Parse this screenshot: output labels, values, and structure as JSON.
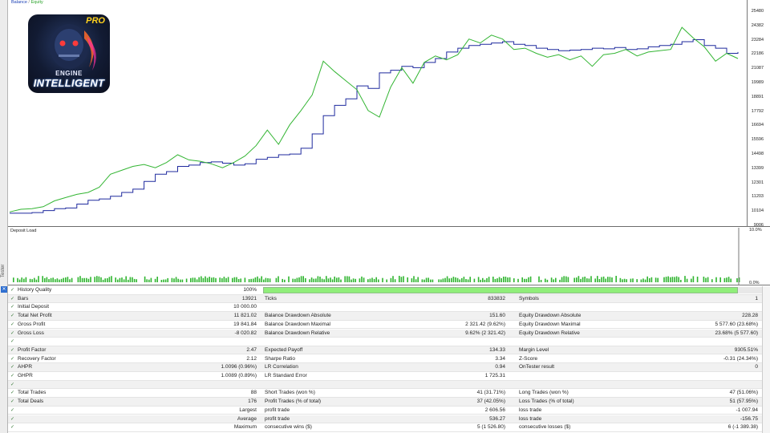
{
  "chart": {
    "legend_balance": "Balance",
    "legend_sep": "/",
    "legend_equity": "Equity",
    "y_ticks": [
      "25480",
      "24382",
      "23284",
      "22186",
      "21087",
      "19989",
      "18891",
      "17792",
      "16694",
      "15596",
      "14498",
      "13399",
      "12301",
      "11203",
      "10104",
      "9006"
    ],
    "colors": {
      "balance": "#1f2a9e",
      "equity": "#33b533"
    }
  },
  "chart_data": {
    "type": "line",
    "ylim": [
      9006,
      25480
    ],
    "series": [
      {
        "name": "Balance",
        "values": [
          10000,
          10000,
          10050,
          10200,
          10350,
          10400,
          10700,
          11000,
          11100,
          11300,
          11600,
          11850,
          12450,
          13000,
          13200,
          13600,
          13700,
          13900,
          13950,
          13850,
          13700,
          13800,
          14150,
          14300,
          14500,
          14550,
          15000,
          16100,
          17500,
          18300,
          18800,
          19800,
          19600,
          20800,
          21000,
          21300,
          21200,
          21600,
          21900,
          22400,
          22700,
          22900,
          23000,
          23100,
          23200,
          23000,
          22900,
          22700,
          22600,
          22500,
          22550,
          22600,
          22700,
          22650,
          22750,
          22600,
          22650,
          22800,
          22900,
          23000,
          23200,
          23350,
          22900,
          22700,
          22300,
          22400
        ]
      },
      {
        "name": "Equity",
        "values": [
          10100,
          10300,
          10350,
          10500,
          10950,
          11200,
          11450,
          11600,
          12000,
          13000,
          13300,
          13600,
          13750,
          13500,
          13900,
          14500,
          14100,
          14000,
          13800,
          13500,
          13900,
          14400,
          15200,
          16400,
          15300,
          16800,
          17900,
          19100,
          21700,
          20900,
          20200,
          19500,
          17900,
          17400,
          19700,
          21200,
          20000,
          21600,
          22100,
          21800,
          22200,
          23400,
          23100,
          23700,
          23400,
          22600,
          22700,
          22300,
          22000,
          22200,
          21800,
          22100,
          21300,
          22200,
          22300,
          22600,
          22100,
          22400,
          22500,
          22600,
          24300,
          23500,
          22800,
          21700,
          22300,
          21900
        ]
      }
    ]
  },
  "load": {
    "title": "Deposit Load",
    "ticks": [
      "10.0%",
      "0.0%"
    ]
  },
  "logo": {
    "pro": "PRO",
    "line1": "ENGINE",
    "line2": "INTELLIGENT"
  },
  "tester_tab": "Tester",
  "report": {
    "history_quality": {
      "label": "History Quality",
      "value": "100%"
    },
    "rows": [
      {
        "c1": [
          "Bars",
          "13921"
        ],
        "c2": [
          "Ticks",
          "833832"
        ],
        "c3": [
          "Symbols",
          "1"
        ]
      },
      {
        "c1": [
          "Initial Deposit",
          "10 000.00"
        ],
        "c2": [
          "",
          ""
        ],
        "c3": [
          "",
          ""
        ]
      },
      {
        "c1": [
          "Total Net Profit",
          "11 821.02"
        ],
        "c2": [
          "Balance Drawdown Absolute",
          "151.60"
        ],
        "c3": [
          "Equity Drawdown Absolute",
          "228.28"
        ]
      },
      {
        "c1": [
          "Gross Profit",
          "19 841.84"
        ],
        "c2": [
          "Balance Drawdown Maximal",
          "2 321.42 (9.62%)"
        ],
        "c3": [
          "Equity Drawdown Maximal",
          "5 577.60 (23.68%)"
        ]
      },
      {
        "c1": [
          "Gross Loss",
          "-8 020.82"
        ],
        "c2": [
          "Balance Drawdown Relative",
          "9.62% (2 321.42)"
        ],
        "c3": [
          "Equity Drawdown Relative",
          "23.68% (5 577.60)"
        ]
      },
      {
        "c1": [
          "",
          ""
        ],
        "c2": [
          "",
          ""
        ],
        "c3": [
          "",
          ""
        ]
      },
      {
        "c1": [
          "Profit Factor",
          "2.47"
        ],
        "c2": [
          "Expected Payoff",
          "134.33"
        ],
        "c3": [
          "Margin Level",
          "9305.51%"
        ]
      },
      {
        "c1": [
          "Recovery Factor",
          "2.12"
        ],
        "c2": [
          "Sharpe Ratio",
          "3.34"
        ],
        "c3": [
          "Z-Score",
          "-0.31 (24.34%)"
        ]
      },
      {
        "c1": [
          "AHPR",
          "1.0096 (0.96%)"
        ],
        "c2": [
          "LR Correlation",
          "0.94"
        ],
        "c3": [
          "OnTester result",
          "0"
        ]
      },
      {
        "c1": [
          "GHPR",
          "1.0089 (0.89%)"
        ],
        "c2": [
          "LR Standard Error",
          "1 725.31"
        ],
        "c3": [
          "",
          ""
        ]
      },
      {
        "c1": [
          "",
          ""
        ],
        "c2": [
          "",
          ""
        ],
        "c3": [
          "",
          ""
        ]
      },
      {
        "c1": [
          "Total Trades",
          "88"
        ],
        "c2": [
          "Short Trades (won %)",
          "41 (31.71%)"
        ],
        "c3": [
          "Long Trades (won %)",
          "47 (51.06%)"
        ]
      },
      {
        "c1": [
          "Total Deals",
          "176"
        ],
        "c2": [
          "Profit Trades (% of total)",
          "37 (42.05%)"
        ],
        "c3": [
          "Loss Trades (% of total)",
          "51 (57.95%)"
        ]
      },
      {
        "c1": [
          "",
          "Largest"
        ],
        "c2": [
          "profit trade",
          "2 606.56"
        ],
        "c3": [
          "loss trade",
          "-1 007.94"
        ]
      },
      {
        "c1": [
          "",
          "Average"
        ],
        "c2": [
          "profit trade",
          "536.27"
        ],
        "c3": [
          "loss trade",
          "-156.75"
        ]
      },
      {
        "c1": [
          "",
          "Maximum"
        ],
        "c2": [
          "consecutive wins ($)",
          "5 (1 526.80)"
        ],
        "c3": [
          "consecutive losses ($)",
          "6 (-1 389.38)"
        ]
      }
    ]
  }
}
